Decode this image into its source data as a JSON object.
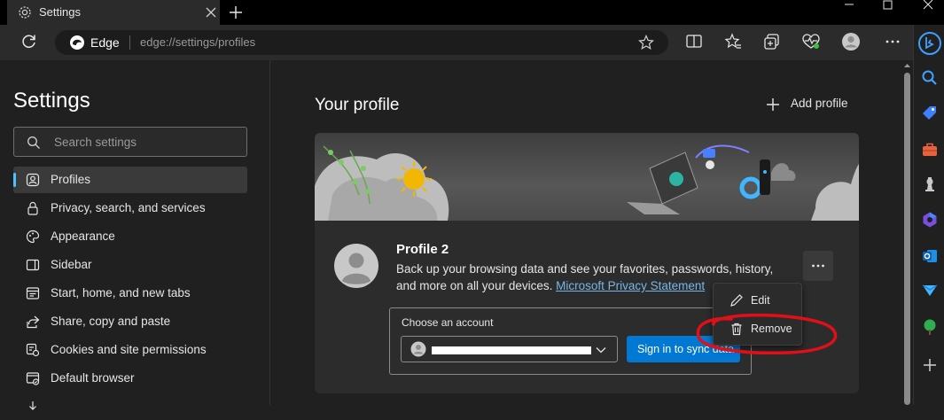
{
  "tab": {
    "title": "Settings"
  },
  "address_bar": {
    "brand": "Edge",
    "url": "edge://settings/profiles"
  },
  "sidebar": {
    "title": "Settings",
    "search_placeholder": "Search settings",
    "items": [
      {
        "label": "Profiles",
        "icon": "profiles-icon",
        "active": true
      },
      {
        "label": "Privacy, search, and services",
        "icon": "lock-icon"
      },
      {
        "label": "Appearance",
        "icon": "palette-icon"
      },
      {
        "label": "Sidebar",
        "icon": "sidebar-icon"
      },
      {
        "label": "Start, home, and new tabs",
        "icon": "home-tabs-icon"
      },
      {
        "label": "Share, copy and paste",
        "icon": "share-icon"
      },
      {
        "label": "Cookies and site permissions",
        "icon": "cookies-icon"
      },
      {
        "label": "Default browser",
        "icon": "browser-icon"
      }
    ]
  },
  "main": {
    "heading": "Your profile",
    "add_profile_label": "Add profile",
    "profile": {
      "name": "Profile 2",
      "description_line1": "Back up your browsing data and see your favorites, passwords, history,",
      "description_line2_prefix": "and more on all your devices. ",
      "privacy_link": "Microsoft Privacy Statement"
    },
    "account": {
      "label": "Choose an account",
      "sign_in_label": "Sign in to sync data"
    },
    "context_menu": {
      "items": [
        {
          "label": "Edit",
          "icon": "pencil-icon"
        },
        {
          "label": "Remove",
          "icon": "trash-icon"
        }
      ]
    }
  },
  "colors": {
    "accent": "#0078d4",
    "link": "#75b6e7",
    "annotation": "#e0101a",
    "background": "#202020",
    "card": "#2c2c2c"
  }
}
